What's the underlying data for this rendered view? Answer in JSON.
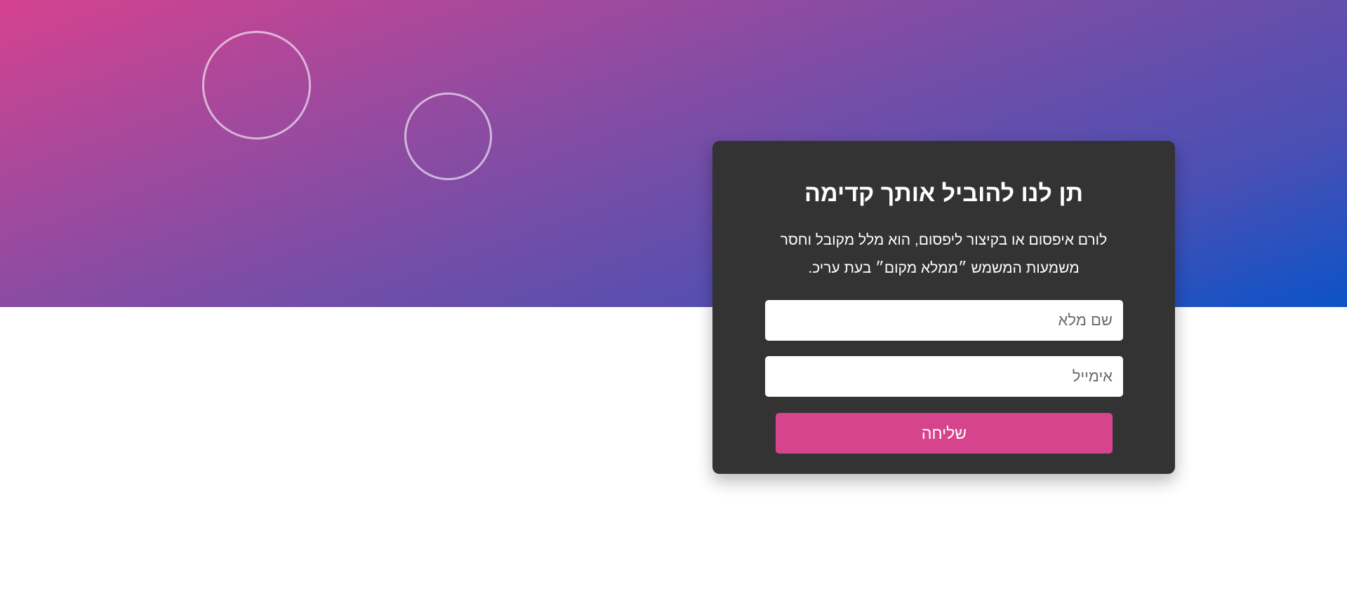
{
  "hero": {
    "gradient_colors": [
      "#d5428f",
      "#0b53c8"
    ]
  },
  "form_card": {
    "title": "תן לנו להוביל אותך קדימה",
    "description": "לורם איפסום או בקיצור ליפסום, הוא מלל מקובל וחסר משמעות המשמש ״ממלא מקום״ בעת עריכ.",
    "name_field": {
      "placeholder": "שם מלא",
      "value": ""
    },
    "email_field": {
      "placeholder": "אימייל",
      "value": ""
    },
    "submit_label": "שליחה",
    "background": "#333333",
    "button_color": "#d6448e"
  }
}
